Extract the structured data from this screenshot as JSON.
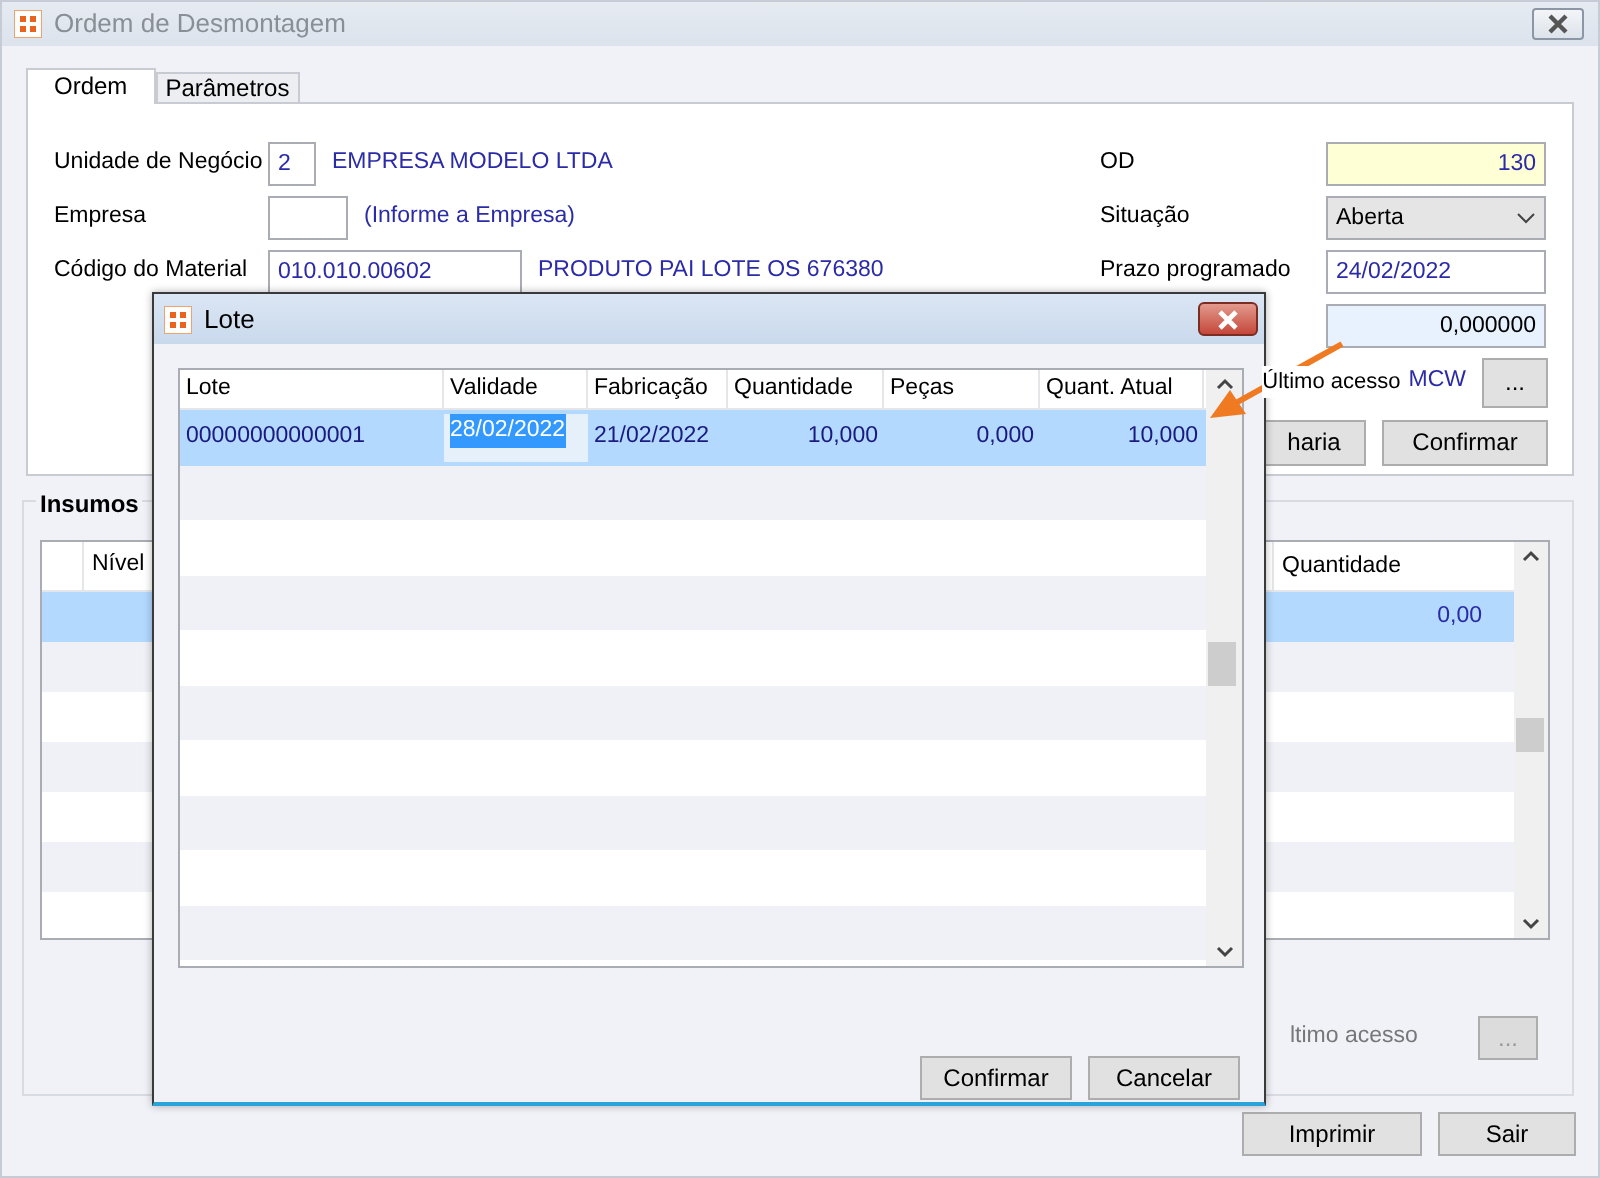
{
  "window": {
    "title": "Ordem de Desmontagem"
  },
  "tabs": [
    {
      "label": "Ordem",
      "selected": true
    },
    {
      "label": "Parâmetros",
      "selected": false
    }
  ],
  "form_left": [
    {
      "label": "Unidade de Negócio",
      "value": "2",
      "description": "EMPRESA MODELO LTDA"
    },
    {
      "label": "Empresa",
      "description": "(Informe a Empresa)"
    },
    {
      "label": "Código do Material",
      "value": "010.010.00602",
      "description": "PRODUTO PAI LOTE OS 676380"
    }
  ],
  "form_right": [
    {
      "label": "OD",
      "value": "130",
      "kind": "readonly"
    },
    {
      "label": "Situação",
      "value": "Aberta",
      "kind": "select"
    },
    {
      "label": "Prazo programado",
      "value": "24/02/2022",
      "kind": "text"
    },
    {
      "value": "0,000000",
      "kind": "number"
    }
  ],
  "last_access": {
    "label": "Último acesso",
    "value": "MCW",
    "button": "..."
  },
  "panel_buttons": [
    "haria",
    "Confirmar"
  ],
  "insumos": {
    "title": "Insumos",
    "columns": [
      "Nível",
      "Quantidade"
    ],
    "rows": [
      {
        "quantidade": "0,00",
        "selected": true
      }
    ],
    "last_access_label": "ltimo acesso",
    "button": "...",
    "button_disabled": true
  },
  "buttons": [
    "Imprimir",
    "Sair"
  ],
  "dialog": {
    "title": "Lote",
    "columns": [
      "Lote",
      "Validade",
      "Fabricação",
      "Quantidade",
      "Peças",
      "Quant. Atual"
    ],
    "rows": [
      {
        "selected": true,
        "cells": [
          {
            "text": "00000000000001",
            "editing": false
          },
          {
            "text": "28/02/2022",
            "editing": true
          },
          {
            "text": "21/02/2022",
            "editing": false
          },
          {
            "text": "10,000",
            "editing": false
          },
          {
            "text": "0,000",
            "editing": false
          },
          {
            "text": "10,000",
            "editing": false
          }
        ]
      }
    ],
    "buttons": [
      "Confirmar",
      "Cancelar"
    ]
  }
}
